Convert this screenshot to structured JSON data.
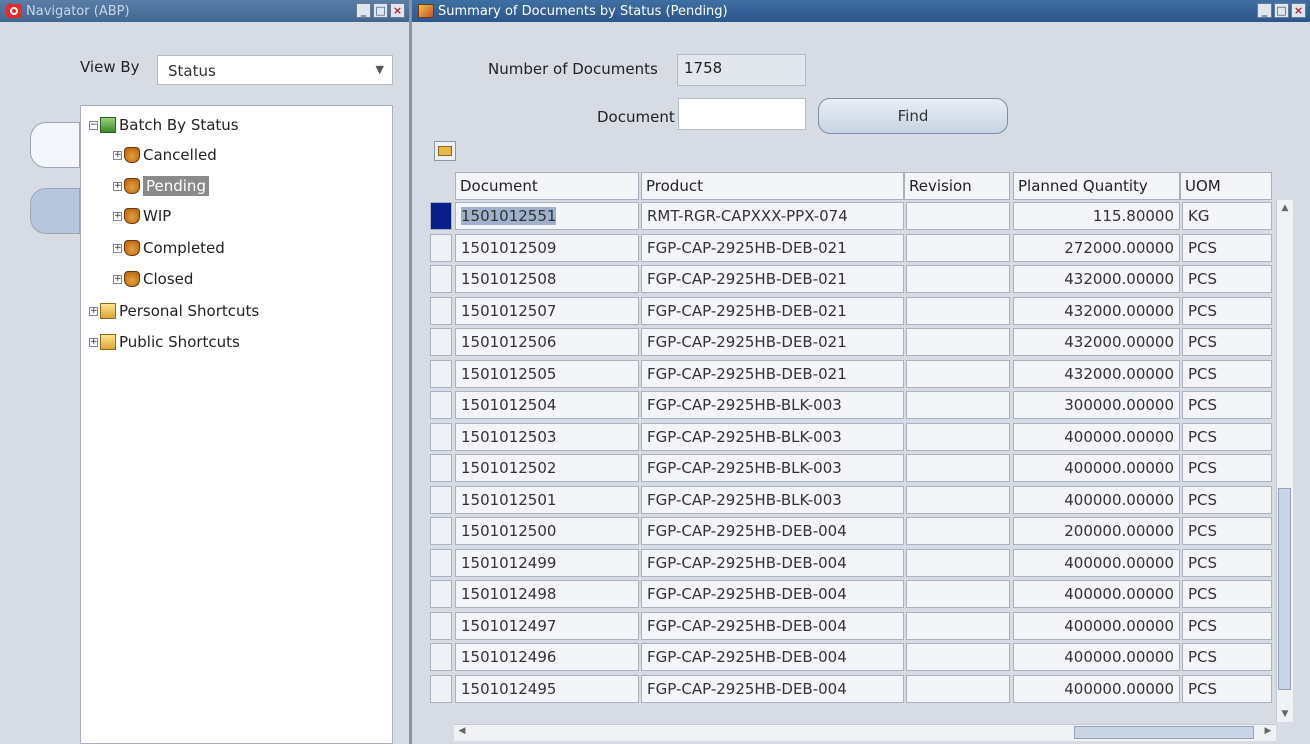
{
  "navigator": {
    "title": "Navigator (ABP)",
    "view_by_label": "View By",
    "view_by_value": "Status",
    "tree": {
      "root": "Batch By Status",
      "statuses": [
        "Cancelled",
        "Pending",
        "WIP",
        "Completed",
        "Closed"
      ],
      "selected": "Pending",
      "personal": "Personal Shortcuts",
      "public": "Public Shortcuts"
    }
  },
  "summary": {
    "title": "Summary of Documents by Status (Pending)",
    "num_docs_label": "Number of Documents",
    "num_docs_value": "1758",
    "document_label": "Document",
    "document_value": "",
    "find_label": "Find",
    "columns": [
      "Document",
      "Product",
      "Revision",
      "Planned Quantity",
      "UOM"
    ],
    "rows": [
      {
        "document": "1501012551",
        "product": "RMT-RGR-CAPXXX-PPX-074",
        "revision": "",
        "qty": "115.80000",
        "uom": "KG"
      },
      {
        "document": "1501012509",
        "product": "FGP-CAP-2925HB-DEB-021",
        "revision": "",
        "qty": "272000.00000",
        "uom": "PCS"
      },
      {
        "document": "1501012508",
        "product": "FGP-CAP-2925HB-DEB-021",
        "revision": "",
        "qty": "432000.00000",
        "uom": "PCS"
      },
      {
        "document": "1501012507",
        "product": "FGP-CAP-2925HB-DEB-021",
        "revision": "",
        "qty": "432000.00000",
        "uom": "PCS"
      },
      {
        "document": "1501012506",
        "product": "FGP-CAP-2925HB-DEB-021",
        "revision": "",
        "qty": "432000.00000",
        "uom": "PCS"
      },
      {
        "document": "1501012505",
        "product": "FGP-CAP-2925HB-DEB-021",
        "revision": "",
        "qty": "432000.00000",
        "uom": "PCS"
      },
      {
        "document": "1501012504",
        "product": "FGP-CAP-2925HB-BLK-003",
        "revision": "",
        "qty": "300000.00000",
        "uom": "PCS"
      },
      {
        "document": "1501012503",
        "product": "FGP-CAP-2925HB-BLK-003",
        "revision": "",
        "qty": "400000.00000",
        "uom": "PCS"
      },
      {
        "document": "1501012502",
        "product": "FGP-CAP-2925HB-BLK-003",
        "revision": "",
        "qty": "400000.00000",
        "uom": "PCS"
      },
      {
        "document": "1501012501",
        "product": "FGP-CAP-2925HB-BLK-003",
        "revision": "",
        "qty": "400000.00000",
        "uom": "PCS"
      },
      {
        "document": "1501012500",
        "product": "FGP-CAP-2925HB-DEB-004",
        "revision": "",
        "qty": "200000.00000",
        "uom": "PCS"
      },
      {
        "document": "1501012499",
        "product": "FGP-CAP-2925HB-DEB-004",
        "revision": "",
        "qty": "400000.00000",
        "uom": "PCS"
      },
      {
        "document": "1501012498",
        "product": "FGP-CAP-2925HB-DEB-004",
        "revision": "",
        "qty": "400000.00000",
        "uom": "PCS"
      },
      {
        "document": "1501012497",
        "product": "FGP-CAP-2925HB-DEB-004",
        "revision": "",
        "qty": "400000.00000",
        "uom": "PCS"
      },
      {
        "document": "1501012496",
        "product": "FGP-CAP-2925HB-DEB-004",
        "revision": "",
        "qty": "400000.00000",
        "uom": "PCS"
      },
      {
        "document": "1501012495",
        "product": "FGP-CAP-2925HB-DEB-004",
        "revision": "",
        "qty": "400000.00000",
        "uom": "PCS"
      }
    ]
  }
}
